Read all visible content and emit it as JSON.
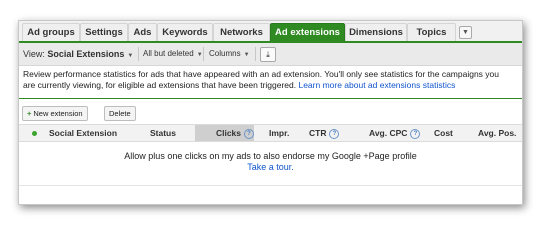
{
  "tabs": [
    {
      "label": "Ad groups",
      "active": false
    },
    {
      "label": "Settings",
      "active": false
    },
    {
      "label": "Ads",
      "active": false
    },
    {
      "label": "Keywords",
      "active": false
    },
    {
      "label": "Networks",
      "active": false
    },
    {
      "label": "Ad extensions",
      "active": true
    },
    {
      "label": "Dimensions",
      "active": false
    },
    {
      "label": "Topics",
      "active": false
    }
  ],
  "toolbar": {
    "view_prefix": "View: ",
    "view_value": "Social Extensions",
    "filter": "All but deleted",
    "columns": "Columns",
    "download_icon": "download-icon"
  },
  "info": {
    "text": "Review performance statistics for ads that have appeared with an ad extension. You'll only see statistics for the campaigns you are currently viewing, for eligible ad extensions that have been triggered. ",
    "link": "Learn more about ad extensions statistics"
  },
  "actions": {
    "new_extension": "New extension",
    "delete": "Delete"
  },
  "table": {
    "columns": [
      "Social Extension",
      "Status",
      "Clicks",
      "Impr.",
      "CTR",
      "Avg. CPC",
      "Cost",
      "Avg. Pos."
    ]
  },
  "empty": {
    "message": "Allow plus one clicks on my ads to also endorse my Google +Page profile",
    "link": "Take a tour."
  },
  "colors": {
    "accent_green": "#2f8a22",
    "link_blue": "#1155cc"
  }
}
